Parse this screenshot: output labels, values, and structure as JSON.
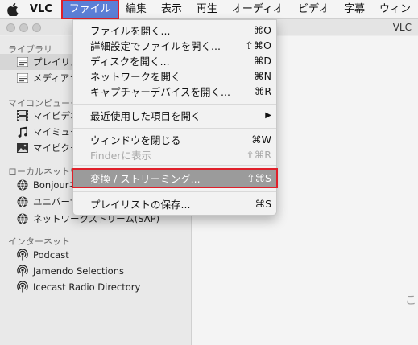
{
  "menubar": {
    "apple_icon": "apple-logo-icon",
    "items": [
      "VLC",
      "ファイル",
      "編集",
      "表示",
      "再生",
      "オーディオ",
      "ビデオ",
      "字幕",
      "ウィン"
    ]
  },
  "window": {
    "title": "VLC"
  },
  "sidebar": {
    "sections": [
      {
        "title": "ライブラリ"
      },
      {
        "title": "マイコンピューター"
      },
      {
        "title": "ローカルネットワーク"
      },
      {
        "title": "インターネット"
      }
    ],
    "library_items": [
      {
        "label": "プレイリスト",
        "icon": "playlist-icon"
      },
      {
        "label": "メディアライブラリ",
        "icon": "media-library-icon"
      }
    ],
    "computer_items": [
      {
        "label": "マイビデオ",
        "icon": "film-icon"
      },
      {
        "label": "マイミュージック",
        "icon": "music-note-icon"
      },
      {
        "label": "マイピクチャ",
        "icon": "picture-icon"
      }
    ],
    "network_items": [
      {
        "label": "Bonjourネットワーク",
        "icon": "network-icon"
      },
      {
        "label": "ユニバーサルプラグアンドプレイ",
        "icon": "network-icon"
      },
      {
        "label": "ネットワークストリーム(SAP)",
        "icon": "network-icon"
      }
    ],
    "internet_items": [
      {
        "label": "Podcast",
        "icon": "podcast-icon"
      },
      {
        "label": "Jamendo Selections",
        "icon": "podcast-icon"
      },
      {
        "label": "Icecast Radio Directory",
        "icon": "podcast-icon"
      }
    ]
  },
  "content": {
    "hint": "こ"
  },
  "file_menu": {
    "items": [
      {
        "label": "ファイルを開く...",
        "shortcut": "⌘O"
      },
      {
        "label": "詳細設定でファイルを開く...",
        "shortcut": "⇧⌘O"
      },
      {
        "label": "ディスクを開く...",
        "shortcut": "⌘D"
      },
      {
        "label": "ネットワークを開く",
        "shortcut": "⌘N"
      },
      {
        "label": "キャプチャーデバイスを開く...",
        "shortcut": "⌘R"
      },
      {
        "label": "最近使用した項目を開く",
        "shortcut": "▶"
      },
      {
        "label": "ウィンドウを閉じる",
        "shortcut": "⌘W"
      },
      {
        "label": "Finderに表示",
        "shortcut": "⇧⌘R"
      },
      {
        "label": "変換 / ストリーミング...",
        "shortcut": "⇧⌘S"
      },
      {
        "label": "プレイリストの保存...",
        "shortcut": "⌘S"
      }
    ]
  },
  "colors": {
    "highlight_border": "#e0202a",
    "menu_active": "#5b7fd6",
    "menu_item_highlight": "#9b9b9b"
  }
}
